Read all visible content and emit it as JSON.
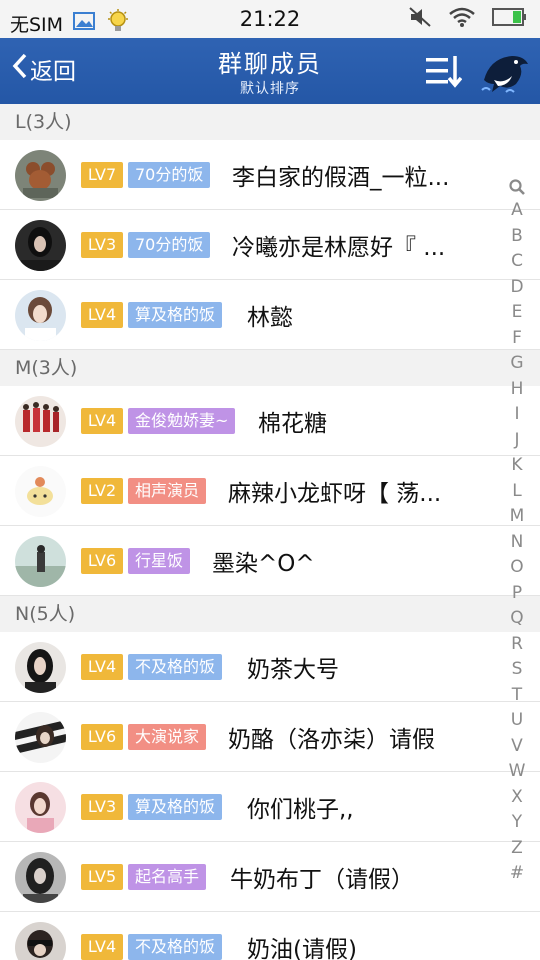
{
  "status_bar": {
    "carrier": "无SIM",
    "time": "21:22"
  },
  "header": {
    "back_label": "返回",
    "title": "群聊成员",
    "subtitle": "默认排序"
  },
  "colors": {
    "level_badge": "#f0b83a",
    "tag_blue": "#8db6ec",
    "tag_purple": "#bf93e6",
    "tag_salmon": "#f28f84",
    "nav_bar": "#2a5eae"
  },
  "sections": [
    {
      "header": "L(3人)",
      "members": [
        {
          "level": "LV7",
          "tag": "70分的饭",
          "name": "李白家的假酒_一粒..."
        },
        {
          "level": "LV3",
          "tag": "70分的饭",
          "name": "冷曦亦是林愿好『 ..."
        },
        {
          "level": "LV4",
          "tag": "算及格的饭",
          "name": "林懿"
        }
      ]
    },
    {
      "header": "M(3人)",
      "members": [
        {
          "level": "LV4",
          "tag": "金俊勉娇妻~",
          "name": "棉花糖"
        },
        {
          "level": "LV2",
          "tag": "相声演员",
          "name": "麻辣小龙虾呀【 荡..."
        },
        {
          "level": "LV6",
          "tag": "行星饭",
          "name": "墨染^O^"
        }
      ]
    },
    {
      "header": "N(5人)",
      "members": [
        {
          "level": "LV4",
          "tag": "不及格的饭",
          "name": "奶茶大号"
        },
        {
          "level": "LV6",
          "tag": "大演说家",
          "name": "奶酪（洛亦柒）请假"
        },
        {
          "level": "LV3",
          "tag": "算及格的饭",
          "name": "你们桃子,,"
        },
        {
          "level": "LV5",
          "tag": "起名高手",
          "name": "牛奶布丁（请假）"
        },
        {
          "level": "LV4",
          "tag": "不及格的饭",
          "name": "奶油(请假)"
        }
      ]
    }
  ],
  "index_letters": [
    "A",
    "B",
    "C",
    "D",
    "E",
    "F",
    "G",
    "H",
    "I",
    "J",
    "K",
    "L",
    "M",
    "N",
    "O",
    "P",
    "Q",
    "R",
    "S",
    "T",
    "U",
    "V",
    "W",
    "X",
    "Y",
    "Z",
    "#"
  ]
}
